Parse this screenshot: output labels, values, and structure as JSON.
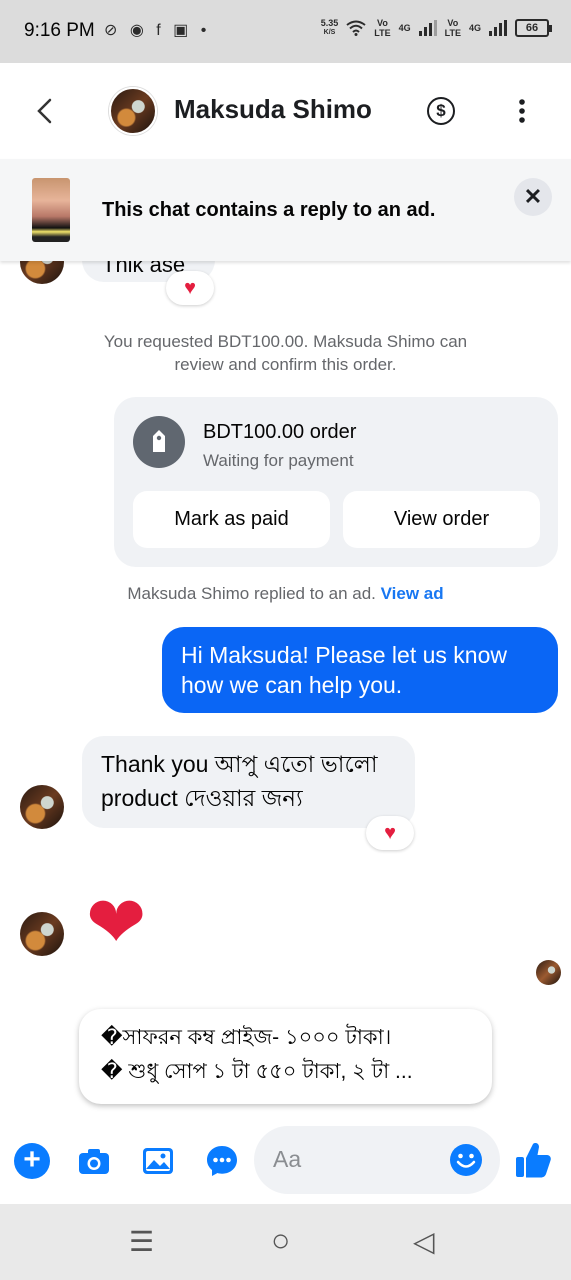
{
  "status_bar": {
    "time": "9:16 PM",
    "left_icons": "⊘ ◉ f ▣ •",
    "speed_value": "5.35",
    "speed_unit": "K/S",
    "vo_label_1": "Vo",
    "lte_label_1": "LTE",
    "net_1": "4G",
    "vo_label_2": "Vo",
    "lte_label_2": "LTE",
    "net_2": "4G",
    "battery": "66"
  },
  "header": {
    "contact_name": "Maksuda Shimo",
    "pay_icon": "$"
  },
  "ad_banner": {
    "text": "This chat contains a reply to an ad.",
    "close": "✕"
  },
  "messages": {
    "partial_text": "Thik ase",
    "partial_reaction": "♥",
    "request_notice": "You requested BDT100.00. Maksuda Shimo can review and confirm this order.",
    "order_title": "BDT100.00 order",
    "order_status": "Waiting for payment",
    "mark_paid": "Mark as paid",
    "view_order": "View order",
    "ad_reply_notice": "Maksuda Shimo replied to an ad.",
    "view_ad": "View ad",
    "outgoing": "Hi Maksuda! Please let us know how we can help you.",
    "incoming_line1": "Thank you আপু এতো ভালো",
    "incoming_line2": "product দেওয়ার জন্য",
    "incoming_reaction": "♥",
    "heart_message": "❤"
  },
  "suggestion": {
    "line1": "�সাফরন কম্ব প্রাইজ- ১০০০ টাকা।",
    "line2": "� শুধু সোপ ১ টা ৫৫০ টাকা, ২ টা ..."
  },
  "composer": {
    "placeholder": "Aa",
    "icons": [
      "plus-icon",
      "camera-icon",
      "gallery-icon",
      "messenger-icon",
      "emoji-icon",
      "thumbs-up-icon"
    ]
  },
  "nav": {
    "recents": "☰",
    "home": "○",
    "back": "◁"
  },
  "colors": {
    "accent": "#0a7cff",
    "outgoing_bubble": "#0a66f5",
    "incoming_bubble": "#f0f2f5",
    "reaction": "#e41e3f"
  }
}
